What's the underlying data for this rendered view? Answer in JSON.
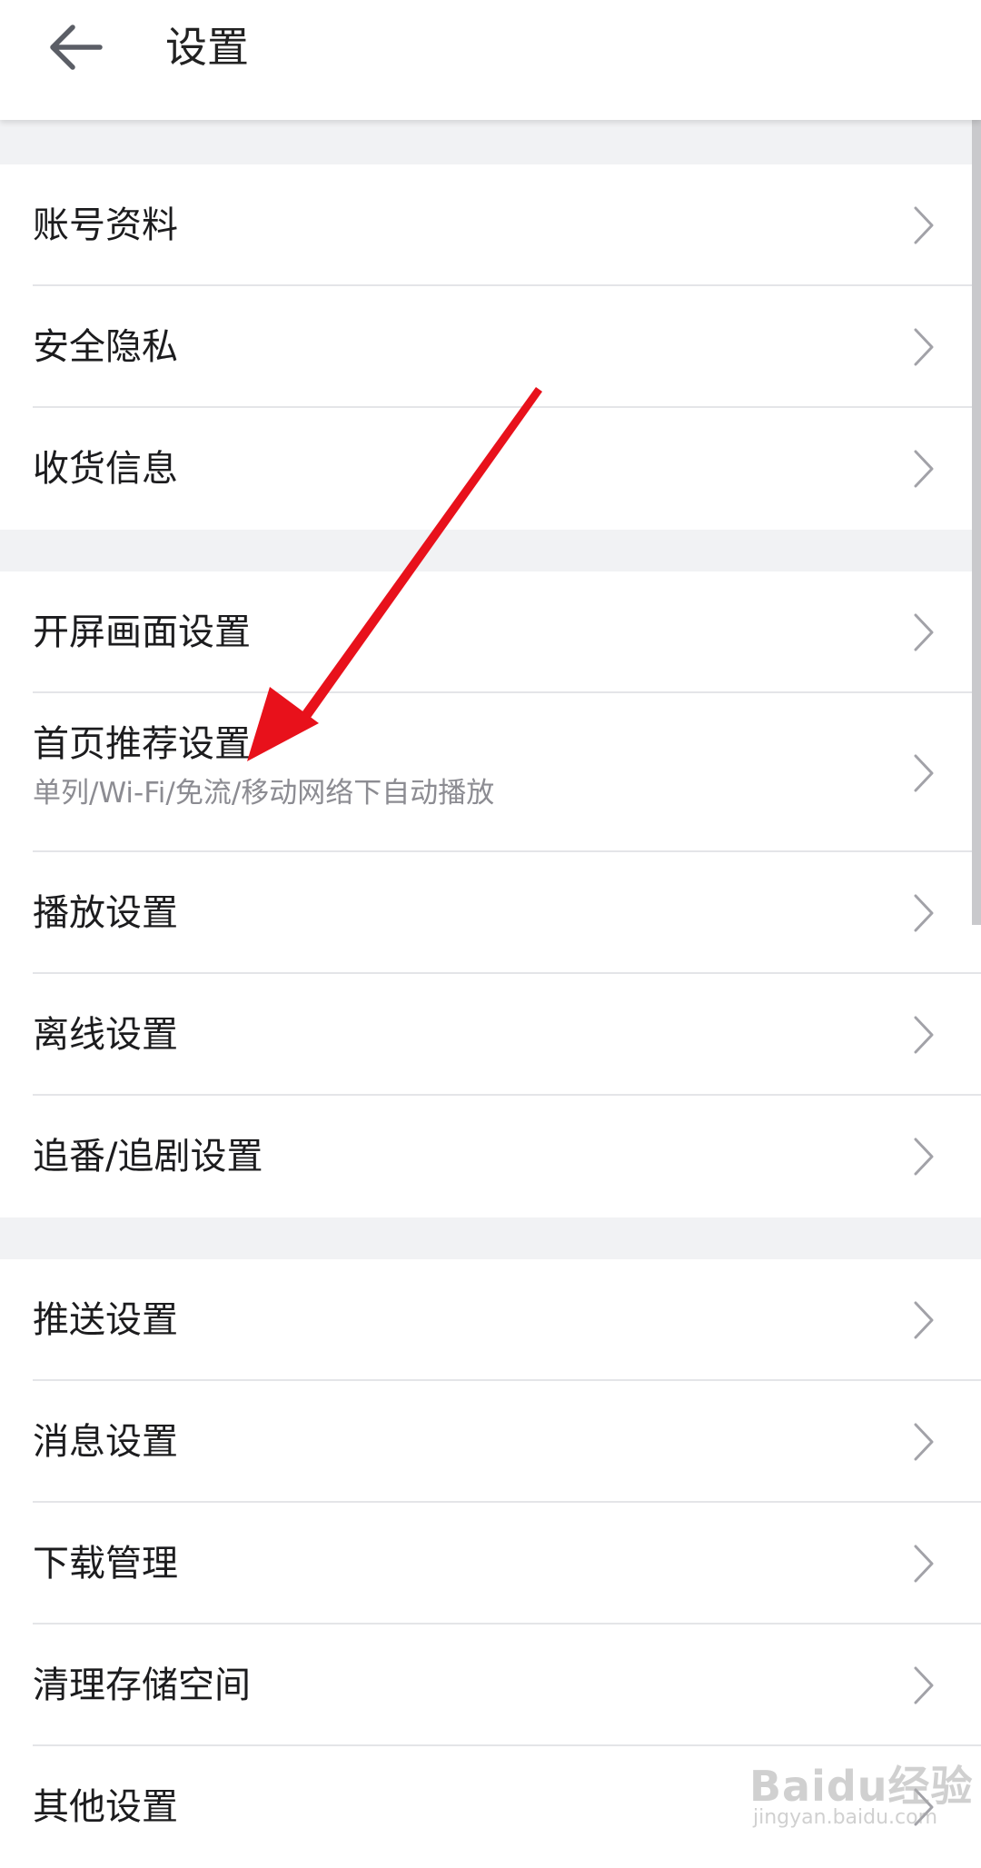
{
  "header": {
    "title": "设置",
    "back_icon": "arrow-left-icon"
  },
  "groups": [
    {
      "items": [
        {
          "label": "账号资料"
        },
        {
          "label": "安全隐私"
        },
        {
          "label": "收货信息"
        }
      ]
    },
    {
      "items": [
        {
          "label": "开屏画面设置"
        },
        {
          "label": "首页推荐设置",
          "sub": "单列/Wi-Fi/免流/移动网络下自动播放"
        },
        {
          "label": "播放设置"
        },
        {
          "label": "离线设置"
        },
        {
          "label": "追番/追剧设置"
        }
      ]
    },
    {
      "items": [
        {
          "label": "推送设置"
        },
        {
          "label": "消息设置"
        },
        {
          "label": "下载管理"
        },
        {
          "label": "清理存储空间"
        },
        {
          "label": "其他设置"
        }
      ]
    }
  ],
  "annotation": {
    "type": "red-arrow",
    "color": "#e8111b",
    "points_to": "首页推荐设置"
  },
  "watermark": {
    "brand": "Baidu经验",
    "url": "jingyan.baidu.com"
  },
  "colors": {
    "background": "#f1f2f4",
    "surface": "#ffffff",
    "divider": "#e4e5e8",
    "secondary_text": "#8c8c92",
    "chevron": "#a2a2a8"
  }
}
